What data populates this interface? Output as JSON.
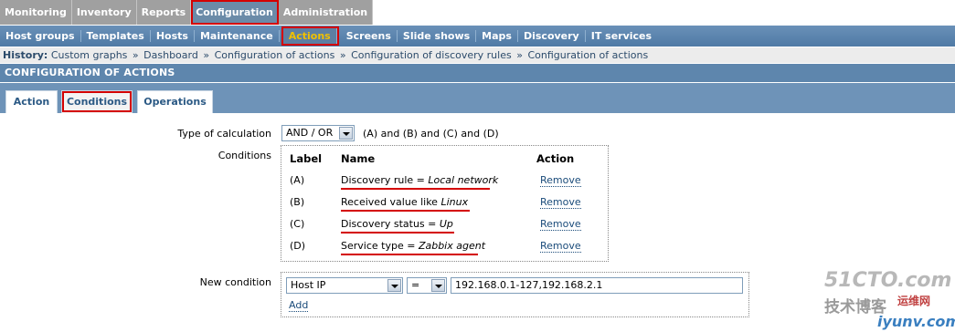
{
  "top_menu": {
    "tabs": [
      "Monitoring",
      "Inventory",
      "Reports",
      "Configuration",
      "Administration"
    ],
    "active": "Configuration"
  },
  "sub_menu": {
    "items": [
      "Host groups",
      "Templates",
      "Hosts",
      "Maintenance",
      "Actions",
      "Screens",
      "Slide shows",
      "Maps",
      "Discovery",
      "IT services"
    ],
    "active": "Actions"
  },
  "history": {
    "label": "History:",
    "items": [
      "Custom graphs",
      "Dashboard",
      "Configuration of actions",
      "Configuration of discovery rules",
      "Configuration of actions"
    ],
    "separator": "»"
  },
  "page_title": "CONFIGURATION OF ACTIONS",
  "form_tabs": {
    "items": [
      "Action",
      "Conditions",
      "Operations"
    ],
    "active": "Conditions"
  },
  "form": {
    "type_of_calculation_label": "Type of calculation",
    "calculation_value": "AND / OR",
    "calculation_expression": "(A) and (B) and (C) and (D)",
    "conditions_label": "Conditions",
    "conditions_headers": {
      "label": "Label",
      "name": "Name",
      "action": "Action"
    },
    "conditions": [
      {
        "label": "(A)",
        "name_prefix": "Discovery rule = ",
        "name_value": "Local network",
        "action": "Remove"
      },
      {
        "label": "(B)",
        "name_prefix": "Received value like ",
        "name_value": "Linux",
        "action": "Remove"
      },
      {
        "label": "(C)",
        "name_prefix": "Discovery status = ",
        "name_value": "Up",
        "action": "Remove"
      },
      {
        "label": "(D)",
        "name_prefix": "Service type = ",
        "name_value": "Zabbix agent",
        "action": "Remove"
      }
    ],
    "new_condition_label": "New condition",
    "new_condition_type": "Host IP",
    "new_condition_operator": "=",
    "new_condition_value": "192.168.0.1-127,192.168.2.1",
    "add_label": "Add"
  },
  "watermark": {
    "line1": "51CTO.com",
    "line2": "技术博客",
    "line3": "运维网",
    "line4": "iyunv.com"
  },
  "colors": {
    "highlight_red": "#d40000",
    "submenu_blue": "#5a84ad",
    "active_submenu_text": "#f0c000",
    "link_blue": "#1a4b7a"
  }
}
